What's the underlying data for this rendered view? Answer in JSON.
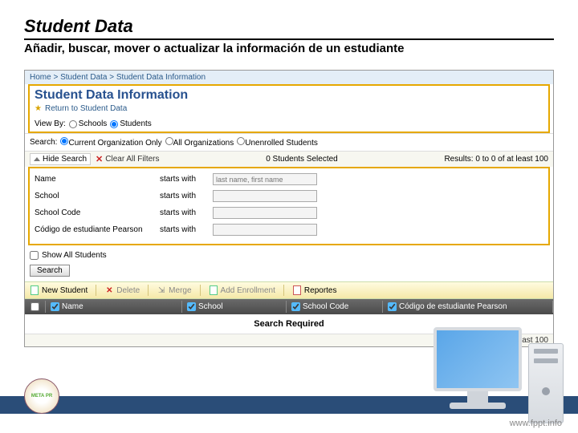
{
  "slide": {
    "title": "Student Data",
    "subtitle": "Añadir, buscar, mover o actualizar la información de un estudiante"
  },
  "breadcrumb": {
    "home": "Home",
    "sep": " > ",
    "p1": "Student Data",
    "p2": "Student Data Information"
  },
  "page_title": "Student Data Information",
  "return_link": "Return to Student Data",
  "viewby": {
    "label": "View By:",
    "opt_schools": "Schools",
    "opt_students": "Students"
  },
  "search_opts": {
    "label": "Search:",
    "current": "Current Organization Only",
    "all": "All Organizations",
    "unenrolled": "Unenrolled Students"
  },
  "results": {
    "selected": "0 Students Selected",
    "range": "Results: 0 to 0 of at least 100"
  },
  "resultbar": {
    "hide": "Hide Search",
    "clear": "Clear All Filters"
  },
  "filters": [
    {
      "label": "Name",
      "op": "starts with",
      "placeholder": "last name, first name"
    },
    {
      "label": "School",
      "op": "starts with",
      "placeholder": ""
    },
    {
      "label": "School Code",
      "op": "starts with",
      "placeholder": ""
    },
    {
      "label": "Código de estudiante Pearson",
      "op": "starts with",
      "placeholder": ""
    }
  ],
  "show_all": "Show All Students",
  "search_btn": "Search",
  "toolbar": {
    "new": "New Student",
    "delete": "Delete",
    "merge": "Merge",
    "add_enroll": "Add Enrollment",
    "reports": "Reportes"
  },
  "columns": [
    "Name",
    "School",
    "School Code",
    "Código de estudiante Pearson"
  ],
  "search_required": "Search Required",
  "footer_url": "www.fppt.info",
  "logo_text": "META PR"
}
